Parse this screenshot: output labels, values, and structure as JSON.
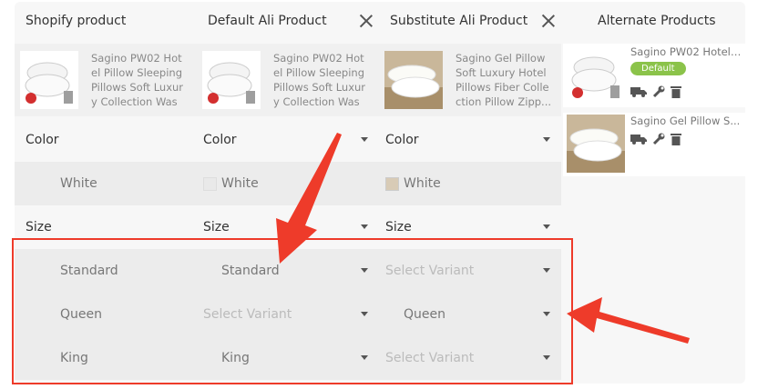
{
  "headers": {
    "shopify": "Shopify product",
    "default_ali": "Default Ali Product",
    "substitute_ali": "Substitute Ali Product",
    "alternate": "Alternate Products"
  },
  "products": {
    "shopify": {
      "title": "Sagino PW02 Hotel Pillow Sleeping Pillows Soft Luxury Collection Wash..."
    },
    "default": {
      "title": "Sagino PW02 Hotel Pillow Sleeping Pillows Soft Luxury Collection Wash..."
    },
    "substitute": {
      "title": "Sagino Gel Pillow Soft Luxury Hotel Pillows Fiber Collection Pillow Zipp..."
    }
  },
  "alternates": [
    {
      "title": "Sagino PW02 Hotel ...",
      "badge": "Default"
    },
    {
      "title": "Sagino Gel Pillow S..."
    }
  ],
  "rows": {
    "color": {
      "label": "Color",
      "default": "Color",
      "substitute": "Color"
    },
    "white": {
      "label": "White",
      "default": "White",
      "substitute": "White"
    },
    "size": {
      "label": "Size",
      "default": "Size",
      "substitute": "Size"
    },
    "standard": {
      "label": "Standard",
      "default": "Standard",
      "substitute": "Select Variant"
    },
    "queen": {
      "label": "Queen",
      "default": "Select Variant",
      "substitute": "Queen"
    },
    "king": {
      "label": "King",
      "default": "King",
      "substitute": "Select Variant"
    }
  },
  "colors": {
    "annotation_red": "#ee3b2a",
    "badge_green": "#8bc34a"
  },
  "icons": [
    "close-icon",
    "truck-icon",
    "wrench-icon",
    "trash-icon",
    "chevron-down-icon"
  ]
}
